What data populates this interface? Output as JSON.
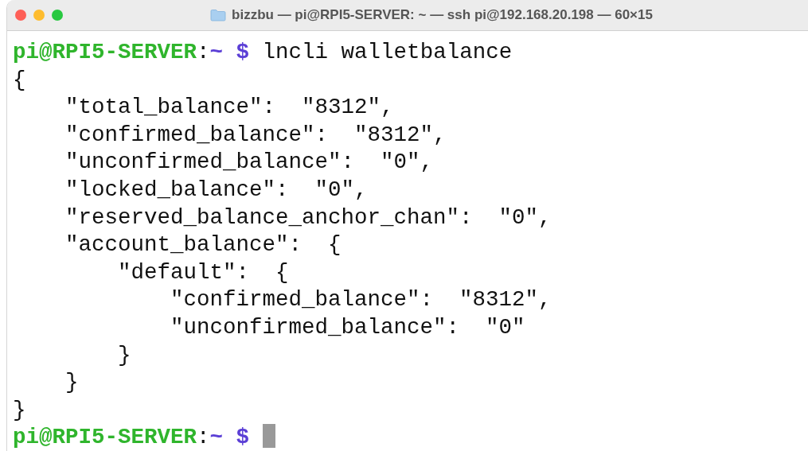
{
  "window": {
    "title": "bizzbu — pi@RPI5-SERVER: ~ — ssh pi@192.168.20.198 — 60×15"
  },
  "lines": [
    {
      "kind": "prompt",
      "host": "pi@RPI5-SERVER",
      "sep": ":",
      "path": "~",
      "symbol": "$",
      "command": "lncli walletbalance"
    },
    {
      "kind": "output",
      "text": "{"
    },
    {
      "kind": "output",
      "text": "    \"total_balance\":  \"8312\","
    },
    {
      "kind": "output",
      "text": "    \"confirmed_balance\":  \"8312\","
    },
    {
      "kind": "output",
      "text": "    \"unconfirmed_balance\":  \"0\","
    },
    {
      "kind": "output",
      "text": "    \"locked_balance\":  \"0\","
    },
    {
      "kind": "output",
      "text": "    \"reserved_balance_anchor_chan\":  \"0\","
    },
    {
      "kind": "output",
      "text": "    \"account_balance\":  {"
    },
    {
      "kind": "output",
      "text": "        \"default\":  {"
    },
    {
      "kind": "output",
      "text": "            \"confirmed_balance\":  \"8312\","
    },
    {
      "kind": "output",
      "text": "            \"unconfirmed_balance\":  \"0\""
    },
    {
      "kind": "output",
      "text": "        }"
    },
    {
      "kind": "output",
      "text": "    }"
    },
    {
      "kind": "output",
      "text": "}"
    },
    {
      "kind": "prompt",
      "host": "pi@RPI5-SERVER",
      "sep": ":",
      "path": "~",
      "symbol": "$"
    }
  ]
}
